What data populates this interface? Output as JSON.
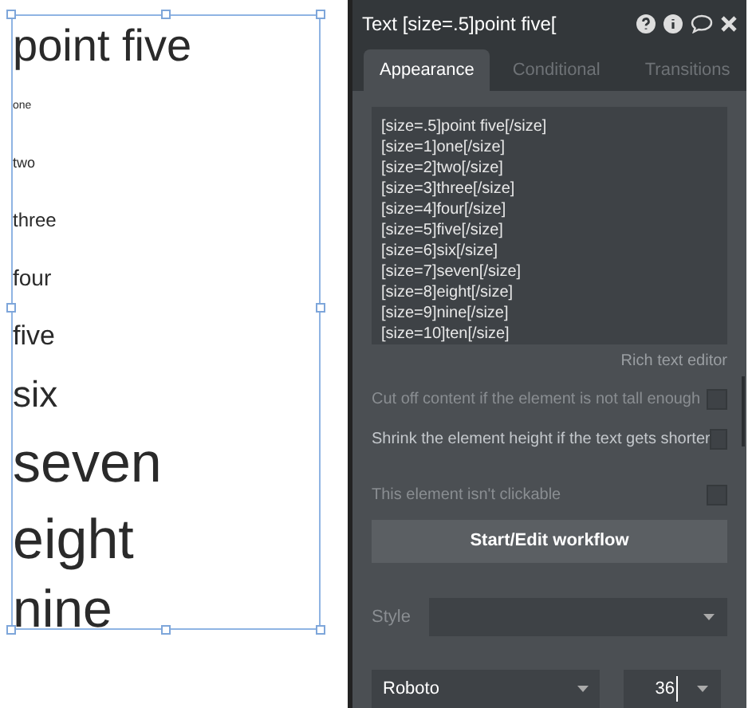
{
  "canvas": {
    "lines": [
      "point five",
      "one",
      "two",
      "three",
      "four",
      "five",
      "six",
      "seven",
      "eight",
      "nine"
    ]
  },
  "panel": {
    "title": "Text [size=.5]point five[",
    "tabs": [
      {
        "label": "Appearance",
        "selected": true
      },
      {
        "label": "Conditional",
        "selected": false
      },
      {
        "label": "Transitions",
        "selected": false
      }
    ],
    "editor": {
      "lines": [
        "[size=.5]point five[/size]",
        "[size=1]one[/size]",
        "[size=2]two[/size]",
        "[size=3]three[/size]",
        "[size=4]four[/size]",
        "[size=5]five[/size]",
        "[size=6]six[/size]",
        "[size=7]seven[/size]",
        "[size=8]eight[/size]",
        "[size=9]nine[/size]",
        "[size=10]ten[/size]"
      ],
      "caption": "Rich text editor"
    },
    "options": [
      {
        "label": "Cut off content if the element is not tall enough",
        "checked": false,
        "disabled": true
      },
      {
        "label": "Shrink the element height if the text gets shorter",
        "checked": false,
        "disabled": false
      },
      {
        "label": "This element isn't clickable",
        "checked": false,
        "disabled": true
      }
    ],
    "workflow_button": "Start/Edit workflow",
    "style": {
      "label": "Style"
    },
    "font": {
      "value": "Roboto"
    },
    "font_size": {
      "value": "36"
    }
  }
}
